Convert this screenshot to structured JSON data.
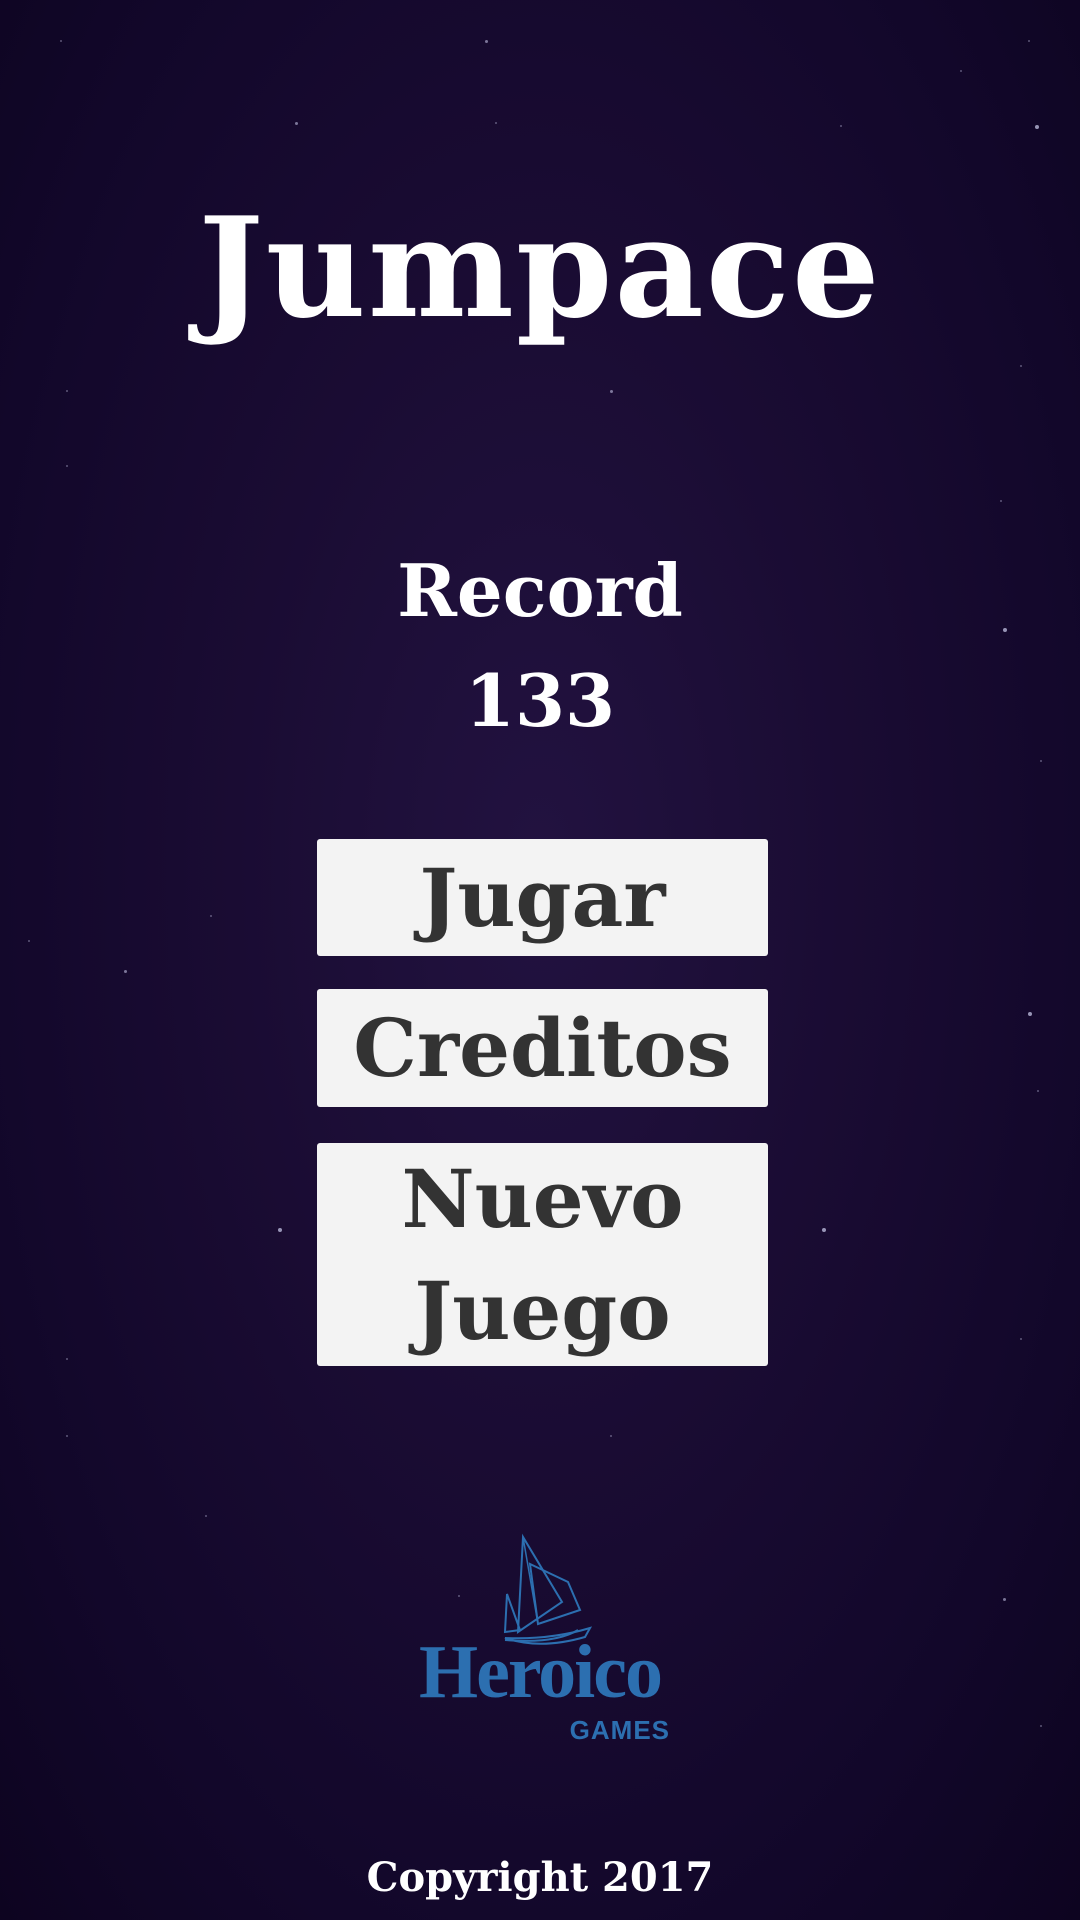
{
  "game": {
    "title": "Jumpace",
    "record_label": "Record",
    "record_value": "133"
  },
  "menu": {
    "play_label": "Jugar",
    "credits_label": "Creditos",
    "new_game_line1": "Nuevo",
    "new_game_line2": "Juego"
  },
  "brand": {
    "name": "Heroico",
    "sub": "GAMES",
    "icon": "sailboat-icon"
  },
  "footer": {
    "copyright": "Copyright 2017"
  },
  "colors": {
    "background": "#1a0c33",
    "button_bg": "#f3f3f3",
    "button_text": "#333333",
    "brand": "#2c6fb0"
  }
}
